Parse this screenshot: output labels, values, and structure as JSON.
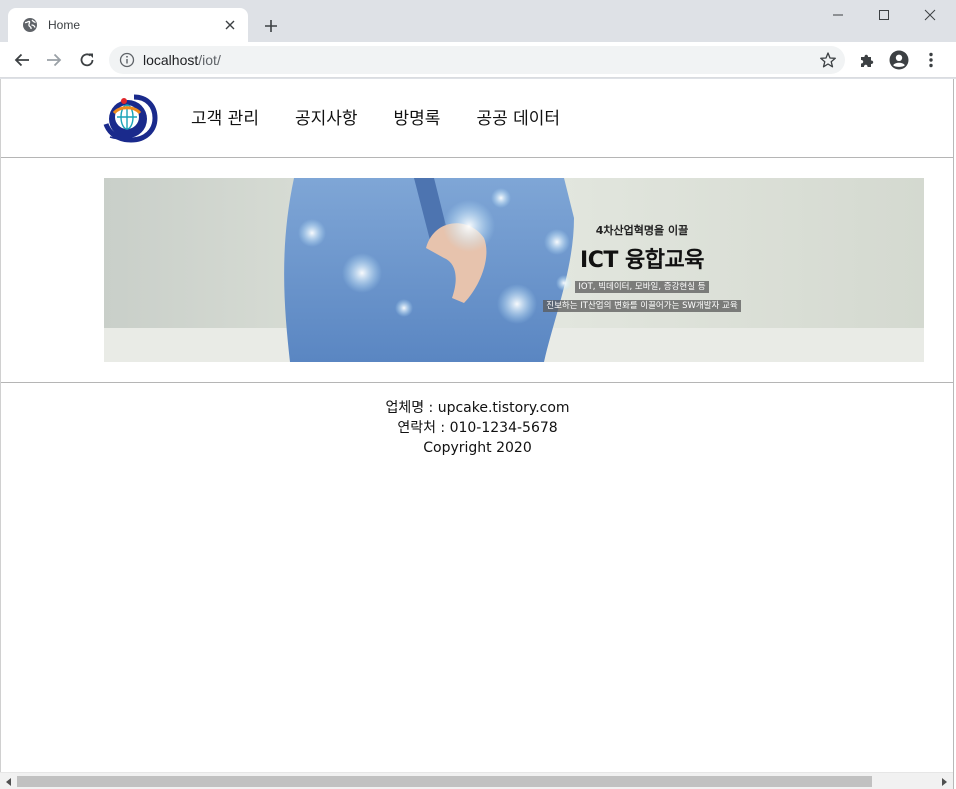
{
  "browser": {
    "tab_title": "Home",
    "url_host": "localhost",
    "url_path": "/iot/"
  },
  "icons": {
    "favicon": "globe-icon",
    "tab_close": "close-icon",
    "new_tab": "plus-icon",
    "back": "arrow-left-icon",
    "forward": "arrow-right-icon",
    "reload": "reload-icon",
    "site_info": "info-icon",
    "bookmark": "star-icon",
    "extensions": "puzzle-icon",
    "profile": "account-icon",
    "menu": "kebab-menu-icon"
  },
  "site": {
    "nav": [
      {
        "label": "고객 관리"
      },
      {
        "label": "공지사항"
      },
      {
        "label": "방명록"
      },
      {
        "label": "공공 데이터"
      }
    ],
    "banner": {
      "subtitle": "4차산업혁명을 이끌",
      "title": "ICT 융합교육",
      "desc_line1": "IOT, 빅데이터, 모바일, 증강현실 등",
      "desc_line2": "진보하는 IT산업의 변화를 이끌어가는 SW개발자 교육"
    },
    "footer": {
      "company": "업체명 : upcake.tistory.com",
      "contact": "연락처 : 010-1234-5678",
      "copyright": "Copyright 2020"
    }
  },
  "colors": {
    "tab_strip": "#dee1e6",
    "omnibox": "#f1f3f4",
    "logo_navy": "#1a2a8c",
    "logo_orange": "#f08a1c",
    "logo_teal": "#1aa3b8"
  }
}
